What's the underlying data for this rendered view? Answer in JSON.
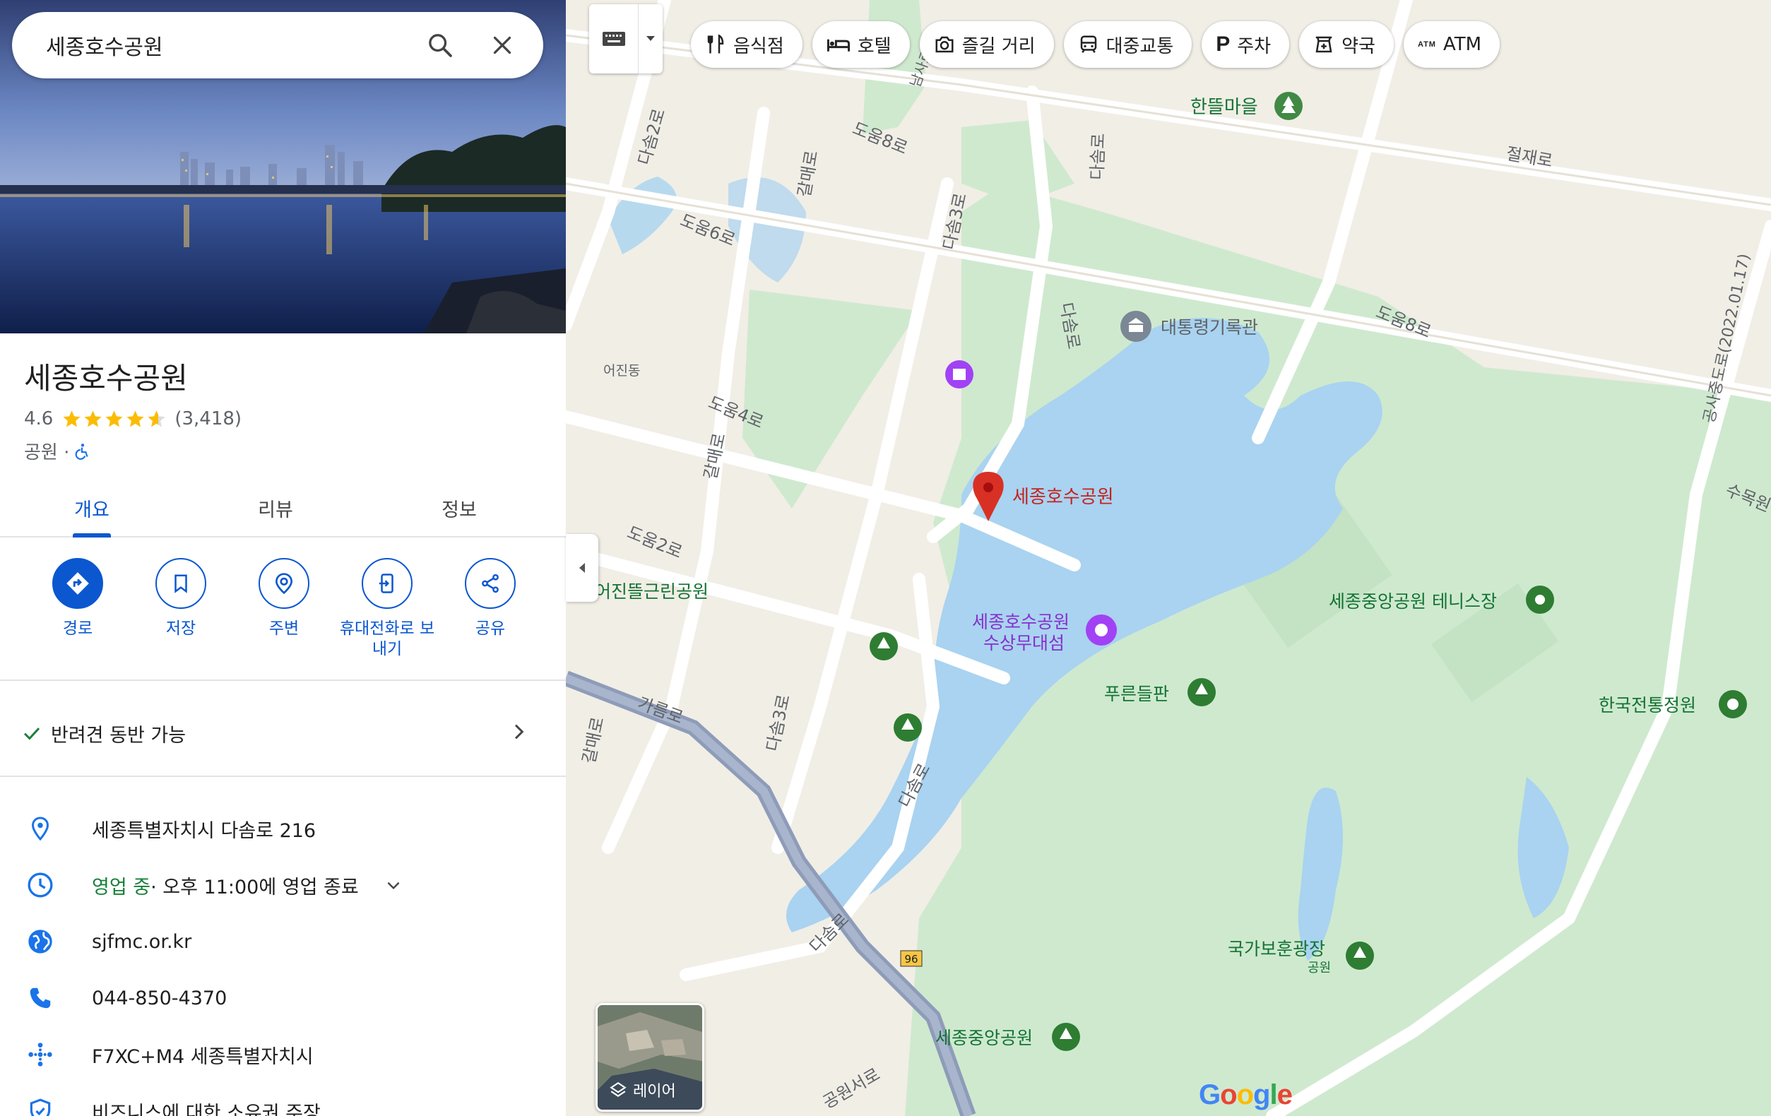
{
  "search": {
    "query": "세종호수공원"
  },
  "place": {
    "title": "세종호수공원",
    "rating": "4.6",
    "stars": 4.6,
    "review_count": "(3,418)",
    "category": "공원 · "
  },
  "tabs": [
    {
      "label": "개요"
    },
    {
      "label": "리뷰"
    },
    {
      "label": "정보"
    }
  ],
  "actions": [
    {
      "label": "경로",
      "icon": "directions-icon"
    },
    {
      "label": "저장",
      "icon": "bookmark-icon"
    },
    {
      "label": "주변",
      "icon": "nearby-icon"
    },
    {
      "label": "휴대전화로 보내기",
      "icon": "send-to-phone-icon"
    },
    {
      "label": "공유",
      "icon": "share-icon"
    }
  ],
  "pet": {
    "label": "반려견 동반 가능"
  },
  "info": {
    "address": "세종특별자치시 다솜로 216",
    "hours_status": "영업 중",
    "hours_detail": " · 오후 11:00에 영업 종료",
    "website": "sjfmc.or.kr",
    "phone": "044-850-4370",
    "plus_code": "F7XC+M4 세종특별자치시",
    "claim": "비즈니스에 대한 소유권 주장"
  },
  "chips": [
    {
      "label": "음식점",
      "icon": "restaurant-icon"
    },
    {
      "label": "호텔",
      "icon": "hotel-icon"
    },
    {
      "label": "즐길 거리",
      "icon": "camera-icon"
    },
    {
      "label": "대중교통",
      "icon": "transit-icon"
    },
    {
      "label": "주차",
      "icon": "parking-icon"
    },
    {
      "label": "약국",
      "icon": "pharmacy-icon"
    },
    {
      "label": "ATM",
      "icon": "atm-icon"
    }
  ],
  "layer": {
    "label": "레이어"
  },
  "map_labels": {
    "hanttеul": "한뜰마을",
    "jeoljae": "절재로",
    "domun8a": "도움8로",
    "domun8b": "도움8로",
    "domun6": "도움6로",
    "domun4": "도움4로",
    "domun2": "도움2로",
    "dasom2": "다솜2로",
    "dasom3a": "다솜3로",
    "dasom3b": "다솜3로",
    "dasomro_a": "다솜로",
    "dasomro_b": "다솜로",
    "dasomro_c": "다솜로",
    "dasomro_d": "다솜로",
    "galmae_a": "갈매로",
    "galmae_b": "갈매로",
    "galmae_c": "갈매로",
    "gareum": "가름로",
    "archive": "대통령기록관",
    "eojin": "어진동",
    "eojin_park": "어진뜰근린공원",
    "selected": "세종호수공원",
    "stage_1": "세종호수공원",
    "stage_2": "수상무대섬",
    "tennis": "세종중앙공원 테니스장",
    "pureun": "푸른들판",
    "traditional": "한국전통정원",
    "plaza_1": "국가보훈광장",
    "plaza_2": "공원",
    "central": "세종중앙공원",
    "gongsa": "공사중도로(2022.01.17)",
    "sumok": "수목원",
    "hwy": "96",
    "namsa": "남사로",
    "gongwonseo": "공원서로"
  }
}
